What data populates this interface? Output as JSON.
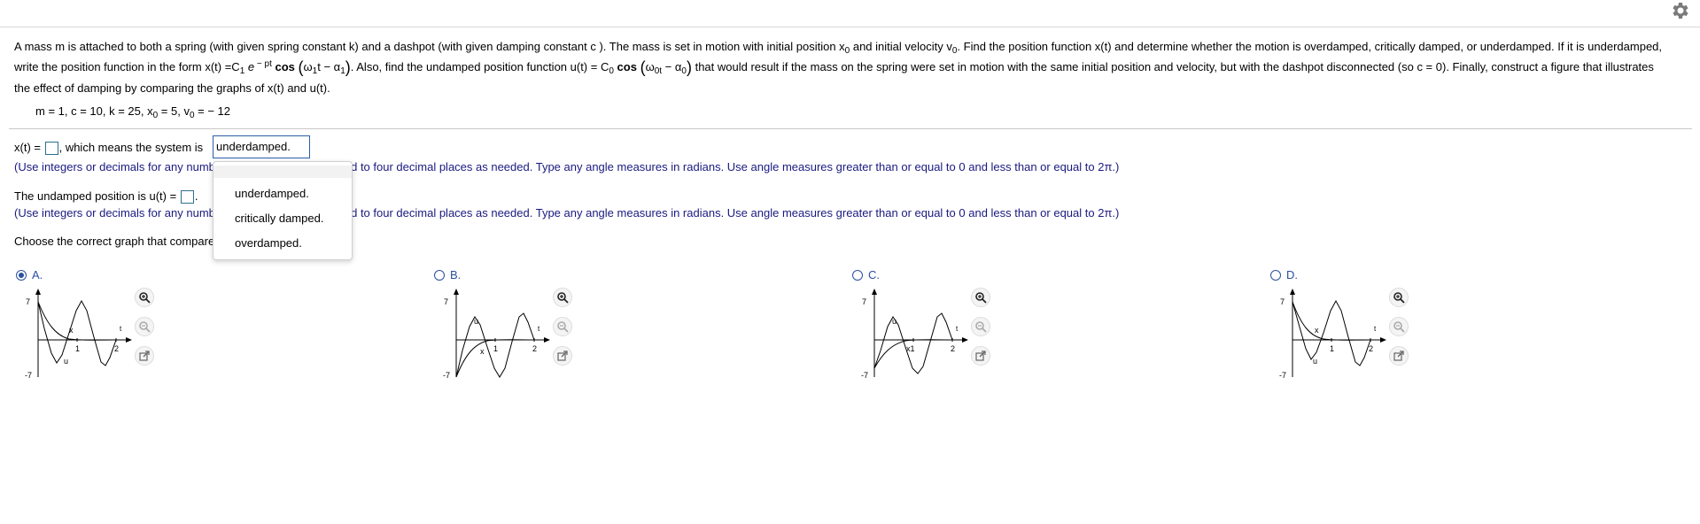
{
  "problem": {
    "p1": "A mass m is attached to both a spring (with given spring constant k) and a dashpot (with given damping constant c ). The mass is set in motion with initial position x",
    "p1_sub": "0",
    "p2": " and initial velocity v",
    "p2_sub": "0",
    "p3": ". Find the position function x(t) and determine whether the motion is overdamped, critically damped, or underdamped. If it is underdamped,",
    "p4": "write the position function in the form x(t) =C",
    "p4_sub": "1",
    "p5": " e",
    "p5_sup": " − pt",
    "p6": "cos",
    "p7": "ω",
    "p7_sub": "1",
    "p8": "t − α",
    "p8_sub": "1",
    "p9": ". Also, find the undamped position function u(t) = C",
    "p9_sub": "0",
    "p10": "cos",
    "p11": "ω",
    "p11_sub": "0t",
    "p12": " − α",
    "p12_sub": "0",
    "p13": " that would result if the mass on the spring were set in motion with the same initial position and velocity, but with the dashpot disconnected (so c = 0). Finally, construct a figure that illustrates",
    "p14": "the effect of damping by comparing the graphs of x(t) and u(t)."
  },
  "params": {
    "a": "m = 1, c = 10, k = 25, x",
    "a_sub": "0",
    "b": " = 5, v",
    "b_sub": "0",
    "c": " = − 12"
  },
  "q1": {
    "prefix": "x(t) = ",
    "middle": ", which means the system is",
    "select_value": "underdamped.",
    "hint_left": "(Use integers or decimals for any numb",
    "hint_right": "nd to four decimal places as needed. Type any angle measures in radians. Use angle measures greater than or equal to 0 and less than or equal to 2π.)"
  },
  "dropdown": {
    "options": [
      "underdamped.",
      "critically damped.",
      "overdamped."
    ]
  },
  "q2": {
    "prefix": "The undamped position is u(t) = ",
    "suffix": ".",
    "hint_left": "(Use integers or decimals for any numb",
    "hint_right": "nd to four decimal places as needed. Type any angle measures in radians. Use angle measures greater than or equal to 0 and less than or equal to 2π.)"
  },
  "q3": {
    "prompt": "Choose the correct graph that compare"
  },
  "choices": [
    {
      "letter": "A.",
      "selected": true
    },
    {
      "letter": "B.",
      "selected": false
    },
    {
      "letter": "C.",
      "selected": false
    },
    {
      "letter": "D.",
      "selected": false
    }
  ],
  "graph_labels": {
    "ymax": "7",
    "ymin": "-7",
    "t": "t",
    "tick1": "1",
    "tick2": "2",
    "u": "u",
    "x": "x",
    "x1": "x1"
  },
  "icons": [
    "gear-icon",
    "zoom-in-icon",
    "zoom-out-icon",
    "external-link-icon"
  ],
  "colors": {
    "accent": "#2a4fa0",
    "hint": "#1a1a80",
    "select_border": "#2c5fa8"
  }
}
